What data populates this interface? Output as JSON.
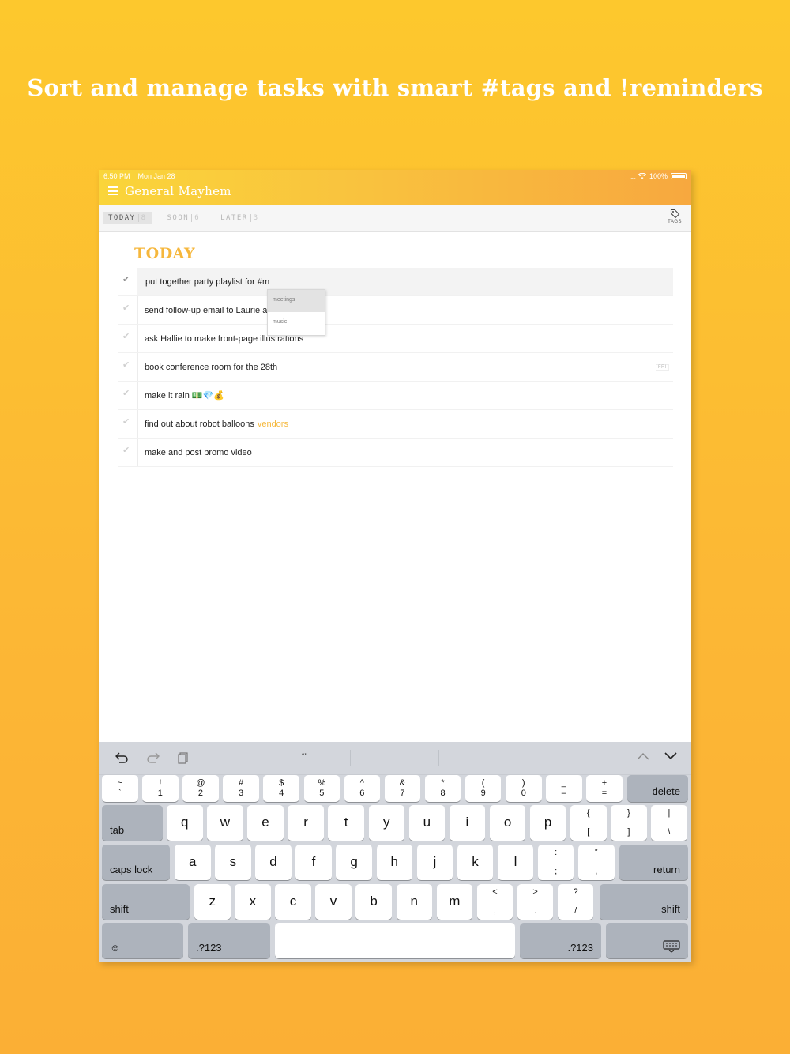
{
  "headline": "Sort and manage tasks with smart #tags and !reminders",
  "status": {
    "time": "6:50 PM",
    "date": "Mon Jan 28",
    "signal": "....",
    "battery": "100%"
  },
  "app": {
    "list_title": "General Mayhem",
    "menu_icon": "hamburger-icon"
  },
  "tabs": [
    {
      "label": "TODAY",
      "count": "8"
    },
    {
      "label": "SOON",
      "count": "6"
    },
    {
      "label": "LATER",
      "count": "3"
    }
  ],
  "tags_button": "TAGS",
  "section_title": "TODAY",
  "tasks": [
    {
      "text": "put together party playlist for #m"
    },
    {
      "text": "send follow-up email to Laurie a"
    },
    {
      "text": "ask Hallie to make front-page illustrations"
    },
    {
      "text": "book conference room for the 28th",
      "badge": "FRI"
    },
    {
      "text": "make it rain 💵💎💰"
    },
    {
      "text": "find out about robot balloons",
      "tag": "vendors"
    },
    {
      "text": "make and post promo video"
    }
  ],
  "suggestions": [
    "meetings",
    "music"
  ],
  "keyboard": {
    "toolbar_quote": "“”",
    "num_row": [
      [
        "~",
        "`"
      ],
      [
        "!",
        "1"
      ],
      [
        "@",
        "2"
      ],
      [
        "#",
        "3"
      ],
      [
        "$",
        "4"
      ],
      [
        "%",
        "5"
      ],
      [
        "^",
        "6"
      ],
      [
        "&",
        "7"
      ],
      [
        "*",
        "8"
      ],
      [
        "(",
        "9"
      ],
      [
        ")",
        "0"
      ],
      [
        "_",
        "–"
      ],
      [
        "+",
        "="
      ]
    ],
    "delete": "delete",
    "tab": "tab",
    "row_q": [
      "q",
      "w",
      "e",
      "r",
      "t",
      "y",
      "u",
      "i",
      "o",
      "p"
    ],
    "row_q_sym": [
      [
        "{",
        "["
      ],
      [
        "}",
        "]"
      ],
      [
        "|",
        "\\"
      ]
    ],
    "caps": "caps lock",
    "row_a": [
      "a",
      "s",
      "d",
      "f",
      "g",
      "h",
      "j",
      "k",
      "l"
    ],
    "row_a_sym": [
      [
        ":",
        ";"
      ],
      [
        "”",
        ","
      ]
    ],
    "return": "return",
    "shift": "shift",
    "row_z": [
      "z",
      "x",
      "c",
      "v",
      "b",
      "n",
      "m"
    ],
    "row_z_sym": [
      [
        "<",
        ","
      ],
      [
        ">",
        "."
      ],
      [
        "?",
        "/"
      ]
    ],
    "emoji": "☺",
    "mode": ".?123"
  }
}
